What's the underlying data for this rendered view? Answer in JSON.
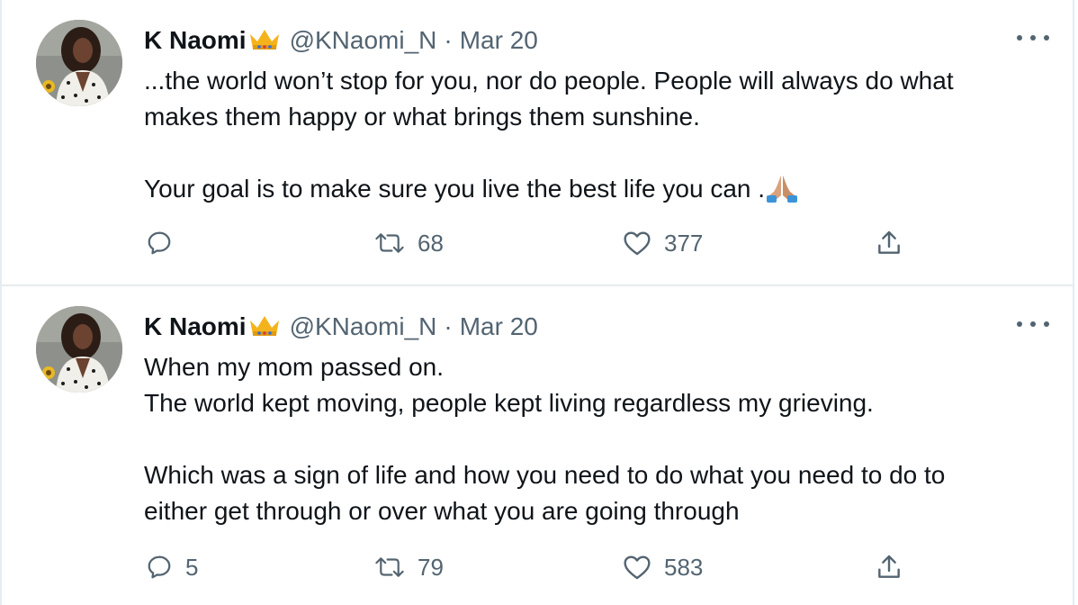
{
  "tweets": [
    {
      "author": {
        "name": "K Naomi",
        "handle": "@KNaomi_N",
        "badge_icon": "crown-emoji-icon"
      },
      "date": "Mar 20",
      "separator": "·",
      "lines": [
        "...the world won’t stop for you, nor do people. People will always do what",
        "makes them happy or what brings them sunshine.",
        "",
        "Your goal is to make sure you live the best life you can ."
      ],
      "trailing_emoji_icon": "folded-hands-emoji-icon",
      "counts": {
        "replies": "",
        "retweets": "68",
        "likes": "377"
      }
    },
    {
      "author": {
        "name": "K Naomi",
        "handle": "@KNaomi_N",
        "badge_icon": "crown-emoji-icon"
      },
      "date": "Mar 20",
      "separator": "·",
      "lines": [
        "When my mom passed on.",
        "The world kept moving, people kept living regardless my grieving.",
        "",
        "Which was a sign of life and how you need to do what you need to do to",
        "either get through or over what you are going through"
      ],
      "counts": {
        "replies": "5",
        "retweets": "79",
        "likes": "583"
      }
    }
  ],
  "icons": [
    "reply-icon",
    "retweet-icon",
    "like-icon",
    "share-icon",
    "more-options-icon"
  ],
  "colors": {
    "text": "#0f1419",
    "secondary": "#536471",
    "divider": "#e6ecf0"
  }
}
